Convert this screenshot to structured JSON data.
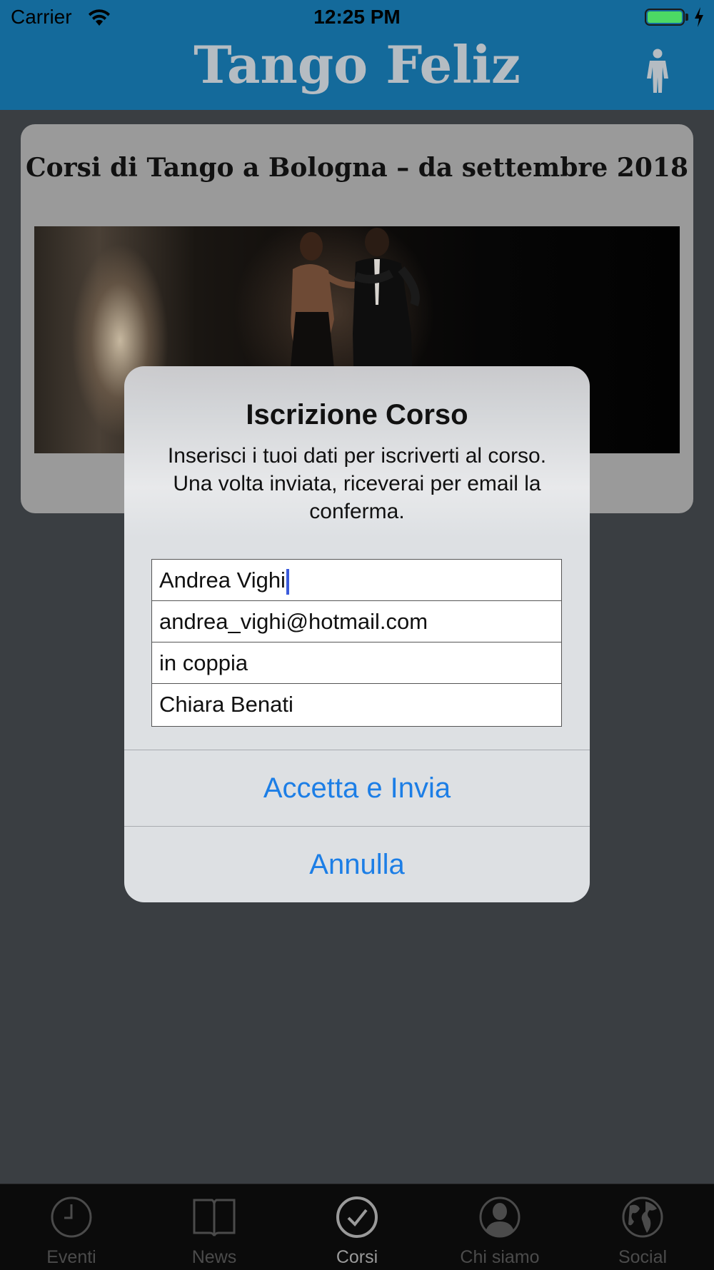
{
  "status_bar": {
    "carrier": "Carrier",
    "time": "12:25 PM",
    "battery_icon": "battery-charging-icon",
    "wifi_icon": "wifi-icon"
  },
  "nav": {
    "title": "Tango Feliz",
    "right_icon": "person-icon"
  },
  "card": {
    "title": "Corsi di Tango a Bologna – da settembre 2018",
    "image": "tango-dancers-photo"
  },
  "alert": {
    "title": "Iscrizione Corso",
    "message": "Inserisci i tuoi dati per iscriverti al corso. Una volta inviata, riceverai per email la conferma.",
    "fields": {
      "name": "Andrea Vighi",
      "email": "andrea_vighi@hotmail.com",
      "mode": "in coppia",
      "partner": "Chiara Benati"
    },
    "confirm_label": "Accetta e Invia",
    "cancel_label": "Annulla"
  },
  "tabs": [
    {
      "label": "Eventi",
      "icon": "clock-icon",
      "active": false
    },
    {
      "label": "News",
      "icon": "book-icon",
      "active": false
    },
    {
      "label": "Corsi",
      "icon": "checkmark-icon",
      "active": true
    },
    {
      "label": "Chi siamo",
      "icon": "person-silhouette-icon",
      "active": false
    },
    {
      "label": "Social",
      "icon": "globe-icon",
      "active": false
    }
  ],
  "colors": {
    "nav_bar": "#146a9b",
    "nav_title": "#b5bcc2",
    "alert_button": "#1c7ee6",
    "battery_fill": "#4cd964"
  }
}
